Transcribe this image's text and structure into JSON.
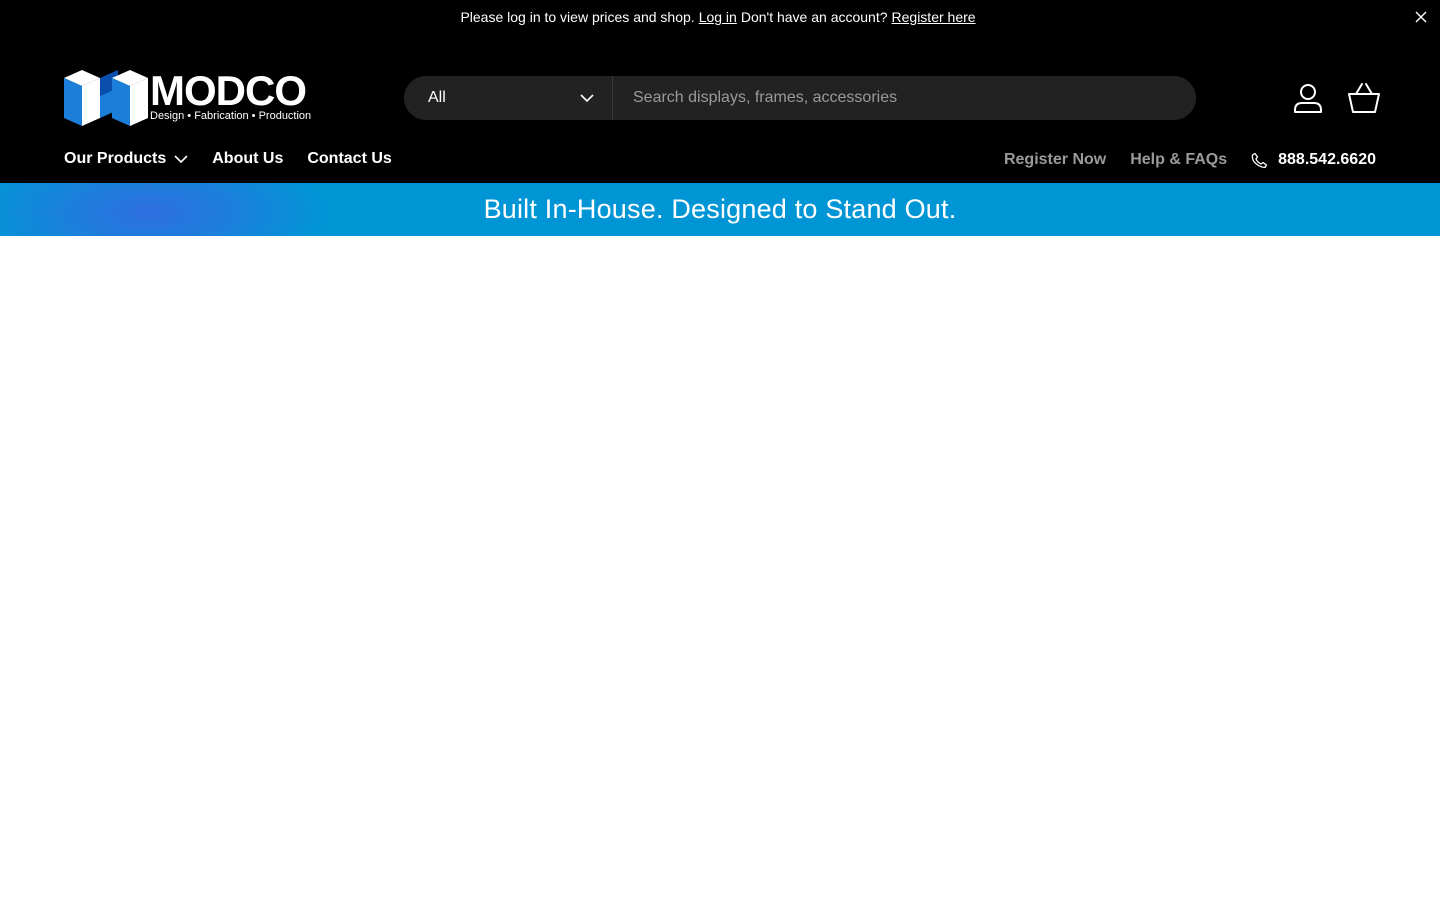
{
  "announcement": {
    "prefix": "Please log in to view prices and shop.",
    "login_link": "Log in",
    "middle": "Don't have an account?",
    "register_link": "Register here"
  },
  "brand": {
    "name": "MODCO",
    "tagline": "Design • Fabrication • Production",
    "colors": {
      "blue": "#1b7fd9",
      "dark_blue": "#0b4fae",
      "white": "#ffffff"
    }
  },
  "search": {
    "category_selected": "All",
    "placeholder": "Search displays, frames, accessories"
  },
  "header_icons": [
    "account-icon",
    "basket-icon"
  ],
  "nav": {
    "left": [
      {
        "label": "Our Products",
        "has_dropdown": true
      },
      {
        "label": "About Us"
      },
      {
        "label": "Contact Us"
      }
    ],
    "right": {
      "register": "Register Now",
      "help": "Help & FAQs",
      "phone": "888.542.6620"
    }
  },
  "banner": {
    "text": "Built In-House. Designed to Stand Out.",
    "color": "#0096d6"
  }
}
